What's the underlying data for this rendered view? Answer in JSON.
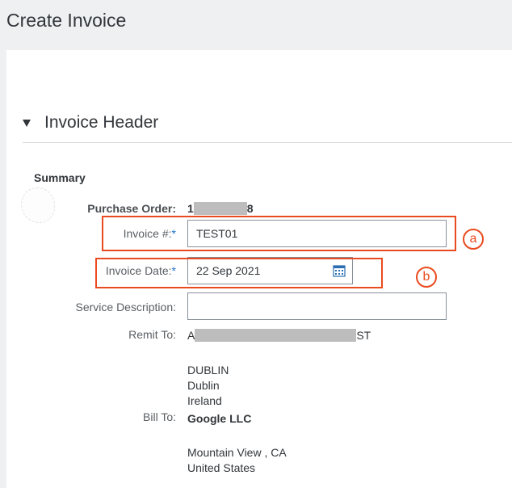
{
  "page": {
    "title": "Create Invoice"
  },
  "section": {
    "title": "Invoice Header"
  },
  "summary": {
    "title": "Summary",
    "purchase_order": {
      "label": "Purchase Order:",
      "prefix": "1",
      "suffix": "8"
    },
    "invoice_number": {
      "label": "Invoice #:",
      "required_mark": "*",
      "value": "TEST01"
    },
    "invoice_date": {
      "label": "Invoice Date:",
      "required_mark": "*",
      "value": "22 Sep 2021"
    },
    "service_description": {
      "label": "Service Description:",
      "value": ""
    },
    "remit_to": {
      "label": "Remit To:",
      "name_prefix": "A",
      "name_suffix": "ST",
      "lines": [
        "DUBLIN",
        "Dublin",
        "Ireland"
      ]
    },
    "bill_to": {
      "label": "Bill To:",
      "name": "Google LLC",
      "lines": [
        "Mountain View , CA",
        "United States"
      ]
    }
  },
  "annotations": {
    "a": "a",
    "b": "b"
  },
  "colors": {
    "callout": "#ea4a1f",
    "required": "#1a73c8",
    "panel": "#ffffff",
    "background": "#eef0f2"
  },
  "icons": {
    "section_toggle": "triangle-down-icon",
    "date_picker": "calendar-icon"
  }
}
